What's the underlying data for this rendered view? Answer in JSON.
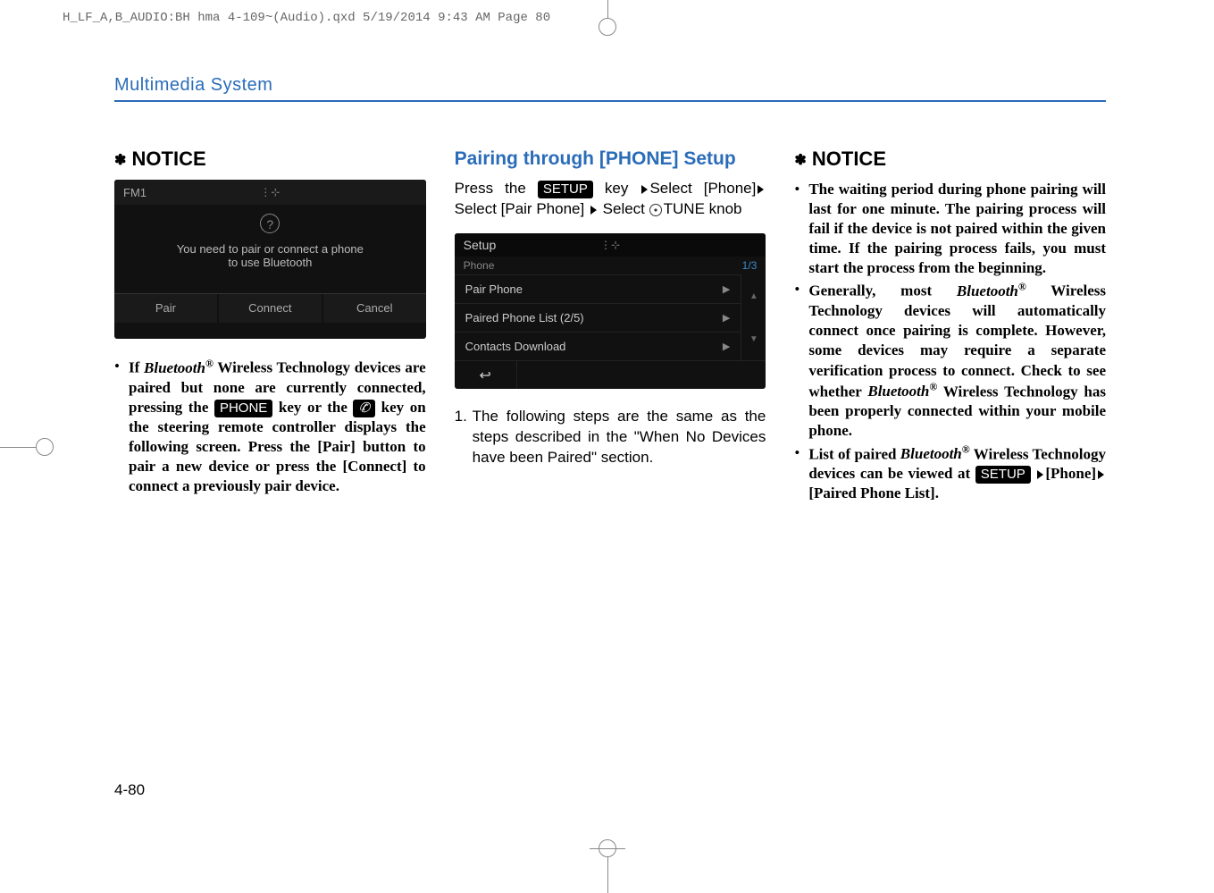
{
  "header_crop": "H_LF_A,B_AUDIO:BH hma 4-109~(Audio).qxd  5/19/2014  9:43 AM  Page 80",
  "section_title": "Multimedia System",
  "page_number": "4-80",
  "keys": {
    "setup": "SETUP",
    "phone": "PHONE"
  },
  "col1": {
    "notice_label": "NOTICE",
    "screenshot": {
      "topbar": "FM1",
      "question_icon": "?",
      "message_line1": "You need to pair or connect a phone",
      "message_line2": "to use Bluetooth",
      "btn_pair": "Pair",
      "btn_connect": "Connect",
      "btn_cancel": "Cancel"
    },
    "bullet_pre": "If ",
    "bullet_bt": "Bluetooth",
    "bullet_reg": "®",
    "bullet_post1": "  Wireless Technology devices are paired but none are currently connected, pressing the ",
    "bullet_post2": " key or the ",
    "bullet_post3": " key on the steering remote controller displays the following screen. Press the [Pair] button to pair a new device or press the [Connect] to connect a previously pair device."
  },
  "col2": {
    "heading": "Pairing through [PHONE] Setup",
    "press_the": "Press the ",
    "key_select": " key  ",
    "select_phone": "Select [Phone]",
    "select_pair_phone": "Select [Pair Phone] ",
    "select_tune": " Select ",
    "tune_knob": "TUNE knob",
    "screenshot": {
      "title": "Setup",
      "subtitle": "Phone",
      "count": "1/3",
      "row1": "Pair Phone",
      "row2": "Paired Phone List (2/5)",
      "row3": "Contacts Download",
      "back": "↩"
    },
    "step1_num": "1.",
    "step1_text": "The following steps are the same as the steps described in the \"When No Devices have been Paired\" section."
  },
  "col3": {
    "notice_label": "NOTICE",
    "b1": "The waiting period during phone pairing will last for one minute. The pairing process will fail if the device is not paired within the given time. If the pairing process fails, you must start the process from the beginning.",
    "b2_pre": "Generally, most ",
    "b2_bt": "Bluetooth",
    "b2_reg": "®",
    "b2_mid": "  Wireless Technology devices will automatically connect once pairing is complete. However, some devices may require a separate verification process to connect. Check to see whether ",
    "b2_bt2": "Bluetooth",
    "b2_reg2": "®",
    "b2_post": " Wireless Technology has been properly connected within your mobile phone.",
    "b3_pre": "List of paired ",
    "b3_bt": "Bluetooth",
    "b3_reg": "®",
    "b3_mid": "  Wireless Technology devices can be viewed at ",
    "b3_phone": "[Phone]",
    "b3_paired": "[Paired Phone List]."
  }
}
